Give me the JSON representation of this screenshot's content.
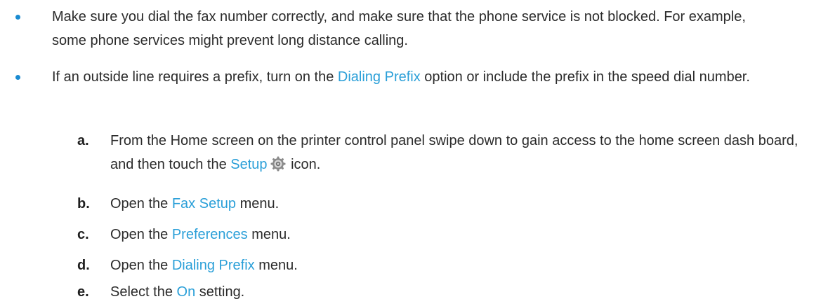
{
  "bullets": [
    {
      "text": "Make sure you dial the fax number correctly, and make sure that the phone service is not blocked. For example, some phone services might prevent long distance calling."
    },
    {
      "before": "If an outside line requires a prefix, turn on the ",
      "link": "Dialing Prefix",
      "after": " option or include the prefix in the speed dial number."
    }
  ],
  "steps": [
    {
      "letter": "a.",
      "before": "From the Home screen on the printer control panel swipe down to gain access to the home screen dash board, and then touch the ",
      "link": "Setup",
      "icon": "gear-icon",
      "after": " icon."
    },
    {
      "letter": "b.",
      "before": "Open the ",
      "link": "Fax Setup",
      "after": " menu."
    },
    {
      "letter": "c.",
      "before": "Open the ",
      "link": "Preferences",
      "after": " menu."
    },
    {
      "letter": "d.",
      "before": "Open the ",
      "link": "Dialing Prefix",
      "after": " menu."
    },
    {
      "letter": "e.",
      "before": "Select the ",
      "link": "On",
      "after": " setting."
    }
  ],
  "colors": {
    "link": "#2a9fd8",
    "bullet": "#1a8bd1",
    "text": "#2b2b2b"
  }
}
